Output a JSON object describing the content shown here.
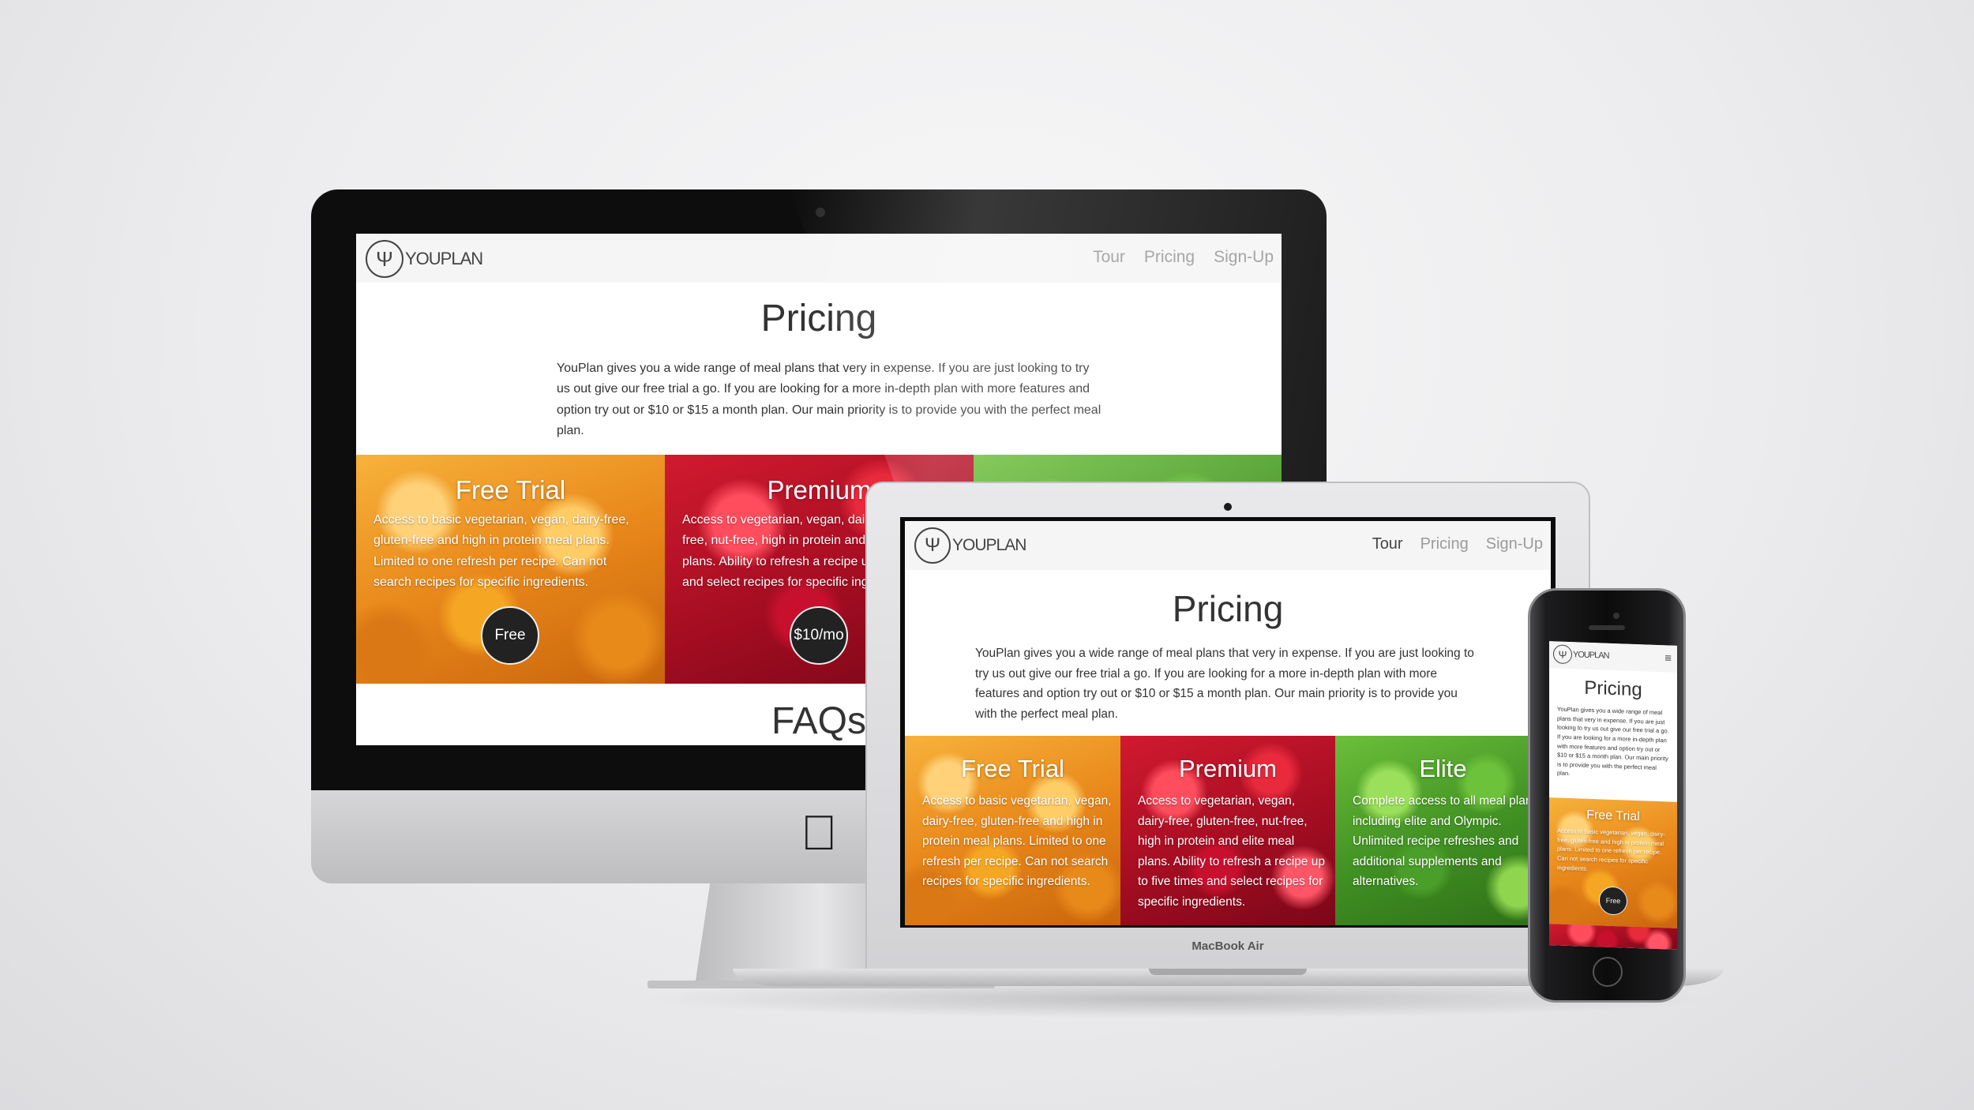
{
  "brand": {
    "logo_text": "YOUPLAN"
  },
  "nav": {
    "tour": "Tour",
    "pricing": "Pricing",
    "signup": "Sign-Up"
  },
  "page": {
    "title": "Pricing",
    "intro": "YouPlan gives you a wide range of meal plans that very in expense. If you are just looking to try us out give our free trial a go. If you are looking for a more in-depth plan with more features and option try out or $10 or $15 a month plan. Our main priority is to provide you with the perfect meal plan.",
    "faqs_heading": "FAQs"
  },
  "plans": [
    {
      "name": "Free Trial",
      "desc_desktop": "Access to basic vegetarian, vegan, dairy-free, gluten-free and high in protein meal plans. Limited to one refresh per recipe. Can not search recipes for specific ingredients.",
      "desc_laptop": "Access to basic vegetarian, vegan, dairy-free, gluten-free and high in protein meal plans. Limited to one refresh per recipe. Can not search recipes for specific ingredients.",
      "price": "Free"
    },
    {
      "name": "Premium",
      "desc_desktop": "Access to vegetarian, vegan, dairy-free, gluten-free, nut-free, high in protein and elite meal plans. Ability to refresh a recipe up to five times and select recipes for specific ingredients.",
      "desc_laptop": "Access to vegetarian, vegan, dairy-free, gluten-free, nut-free, high in protein and elite meal plans. Ability to refresh a recipe up to five times and select recipes for specific ingredients.",
      "price": "$10/mo"
    },
    {
      "name": "Elite",
      "desc_laptop": "Complete access to all meal plans, including elite and Olympic. Unlimited recipe refreshes and additional supplements and alternatives."
    }
  ],
  "devices": {
    "laptop_label": "MacBook Air"
  },
  "colors": {
    "nav_bg": "#f5f5f5",
    "button_bg": "#222222",
    "text": "#333333"
  }
}
